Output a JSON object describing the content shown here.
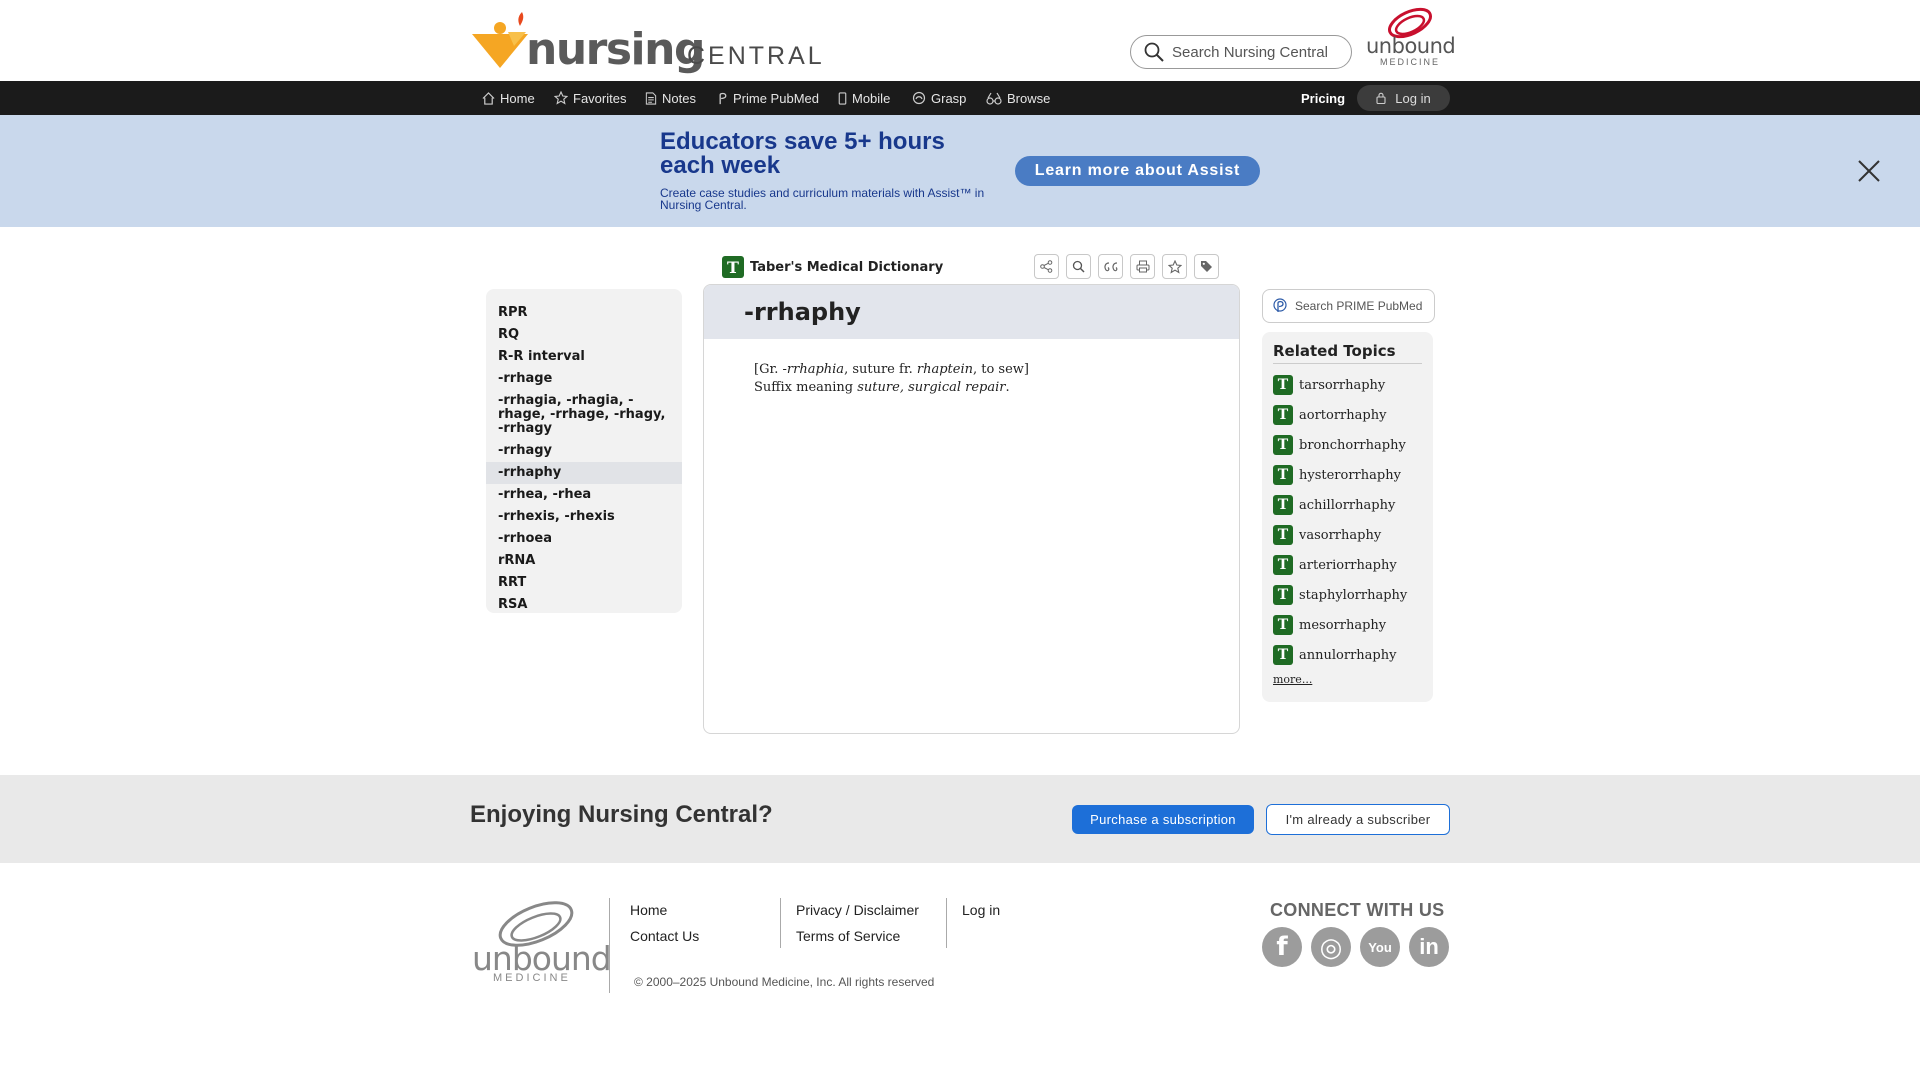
{
  "header": {
    "logo_main": "nursing",
    "logo_sub": "CENTRAL",
    "search_placeholder": "Search Nursing Central",
    "brand_name": "unbound",
    "brand_sub": "MEDICINE"
  },
  "nav": {
    "items": [
      {
        "label": "Home",
        "icon": "home-icon"
      },
      {
        "label": "Favorites",
        "icon": "star-icon"
      },
      {
        "label": "Notes",
        "icon": "notes-icon"
      },
      {
        "label": "Prime PubMed",
        "icon": "pubmed-icon"
      },
      {
        "label": "Mobile",
        "icon": "mobile-icon"
      },
      {
        "label": "Grasp",
        "icon": "grasp-icon"
      },
      {
        "label": "Browse",
        "icon": "browse-icon"
      }
    ],
    "pricing": "Pricing",
    "login": "Log in"
  },
  "promo": {
    "title": "Educators save 5+ hours each week",
    "subtitle": "Create case studies and curriculum materials with Assist™ in Nursing Central.",
    "button": "Learn more about Assist"
  },
  "book": {
    "icon_letter": "T",
    "title": "Taber's Medical Dictionary"
  },
  "toolbar": [
    "share-icon",
    "search-icon",
    "cite-icon",
    "print-icon",
    "favorite-icon",
    "tag-icon"
  ],
  "left_list": {
    "items": [
      "RPR",
      "RQ",
      "R-R interval",
      "-rrhage",
      "-rrhagia, -rhagia, -rhage, -rrhage, -rhagy, -rrhagy",
      "-rrhagy",
      "-rrhaphy",
      "-rrhea, -rhea",
      "-rrhexis, -rhexis",
      "-rrhoea",
      "rRNA",
      "RRT",
      "RSA"
    ],
    "active_index": 6
  },
  "entry": {
    "title": "-rrhaphy",
    "etym_open": "[Gr. ",
    "etym_word1": "-rrhaphia",
    "etym_mid": ", suture fr. ",
    "etym_word2": "rhaptein",
    "etym_close": ", to sew]",
    "def_prefix": "Suffix meaning ",
    "def_italic": "suture, surgical repair",
    "def_suffix": "."
  },
  "right": {
    "pubmed_search": "Search PRIME PubMed",
    "related_title": "Related Topics",
    "related": [
      "tarsorrhaphy",
      "aortorrhaphy",
      "bronchorrhaphy",
      "hysterorrhaphy",
      "achillorrhaphy",
      "vasorrhaphy",
      "arteriorrhaphy",
      "staphylorrhaphy",
      "mesorrhaphy",
      "annulorrhaphy"
    ],
    "more": "more..."
  },
  "subscribe": {
    "title": "Enjoying Nursing Central?",
    "purchase": "Purchase a subscription",
    "subscriber": "I'm already a subscriber"
  },
  "footer": {
    "logo_text": "unbound",
    "logo_sub": "MEDICINE",
    "col1": [
      "Home",
      "Contact Us"
    ],
    "col2": [
      "Privacy / Disclaimer",
      "Terms of Service"
    ],
    "col3": [
      "Log in"
    ],
    "copyright": "© 2000–2025 Unbound Medicine, Inc. All rights reserved",
    "connect": "CONNECT WITH US",
    "social": [
      {
        "icon": "facebook-icon",
        "glyph": "f"
      },
      {
        "icon": "instagram-icon",
        "glyph": "◎"
      },
      {
        "icon": "youtube-icon",
        "glyph": "You"
      },
      {
        "icon": "linkedin-icon",
        "glyph": "in"
      }
    ]
  },
  "colors": {
    "nav_bg": "#1b1b1b",
    "promo_bg": "#c9d8ec",
    "promo_text": "#18388c",
    "promo_button": "#4a7cc4",
    "taber_green": "#1f6b24",
    "primary_button": "#1d6fd8",
    "logo_orange": "#f5a623"
  }
}
